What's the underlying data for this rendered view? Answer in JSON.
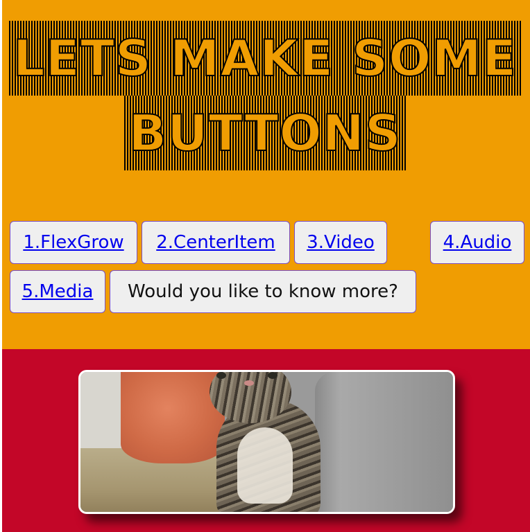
{
  "heading": {
    "line1": "LETS MAKE SOME",
    "line2": "BUTTONS"
  },
  "buttons": [
    {
      "label": "1.FlexGrow"
    },
    {
      "label": "2.CenterItem"
    },
    {
      "label": "3.Video"
    },
    {
      "label": "4.Audio"
    },
    {
      "label": "5.Media"
    },
    {
      "label": "Would you like to know more?"
    }
  ],
  "colors": {
    "top_background": "#f09d02",
    "bottom_background": "#c30628",
    "button_background": "#efefef",
    "button_border": "#7a4ec4",
    "link": "#0000ee"
  },
  "media": {
    "subject_icon": "kitten-video-icon"
  }
}
